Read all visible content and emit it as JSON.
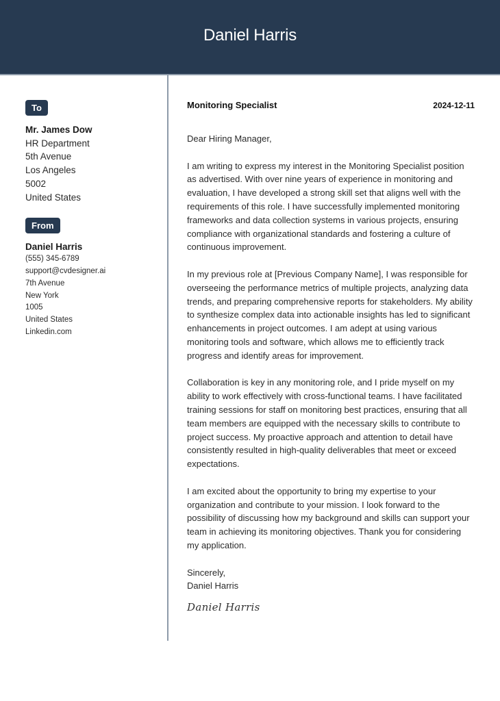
{
  "header": {
    "name": "Daniel Harris"
  },
  "colors": {
    "header_bg": "#273a51",
    "badge_bg": "#273a51",
    "divider": "#8d9aa9"
  },
  "recipient": {
    "badge_label": "To",
    "name": "Mr. James Dow",
    "lines": [
      "HR Department",
      "5th Avenue",
      "Los Angeles",
      "5002",
      "United States"
    ]
  },
  "sender": {
    "badge_label": "From",
    "name": "Daniel Harris",
    "lines": [
      "(555) 345-6789",
      "support@cvdesigner.ai",
      "7th Avenue",
      "New York",
      "1005",
      "United States",
      "Linkedin.com"
    ]
  },
  "letter": {
    "job_title": "Monitoring Specialist",
    "date": "2024-12-11",
    "greeting": "Dear Hiring Manager,",
    "paragraphs": [
      "I am writing to express my interest in the Monitoring Specialist position as advertised. With over nine years of experience in monitoring and evaluation, I have developed a strong skill set that aligns well with the requirements of this role. I have successfully implemented monitoring frameworks and data collection systems in various projects, ensuring compliance with organizational standards and fostering a culture of continuous improvement.",
      "In my previous role at [Previous Company Name], I was responsible for overseeing the performance metrics of multiple projects, analyzing data trends, and preparing comprehensive reports for stakeholders. My ability to synthesize complex data into actionable insights has led to significant enhancements in project outcomes. I am adept at using various monitoring tools and software, which allows me to efficiently track progress and identify areas for improvement.",
      "Collaboration is key in any monitoring role, and I pride myself on my ability to work effectively with cross-functional teams. I have facilitated training sessions for staff on monitoring best practices, ensuring that all team members are equipped with the necessary skills to contribute to project success. My proactive approach and attention to detail have consistently resulted in high-quality deliverables that meet or exceed expectations.",
      "I am excited about the opportunity to bring my expertise to your organization and contribute to your mission. I look forward to the possibility of discussing how my background and skills can support your team in achieving its monitoring objectives. Thank you for considering my application."
    ],
    "closing": "Sincerely,",
    "closing_name": "Daniel Harris",
    "signature": "Daniel Harris"
  }
}
